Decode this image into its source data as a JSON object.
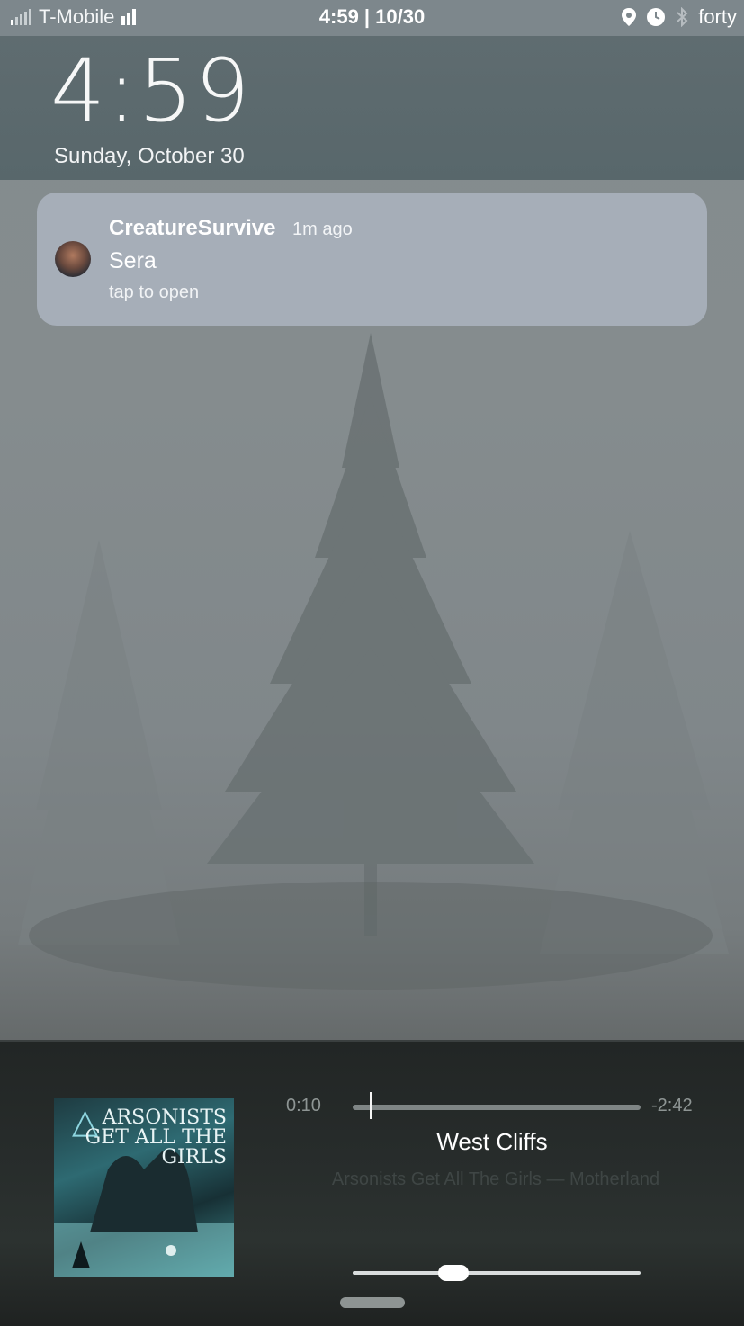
{
  "status_bar": {
    "carrier": "T-Mobile",
    "center": "4:59 | 10/30",
    "right_label": "forty",
    "icons": [
      "signal-icon",
      "wifi-bars-icon",
      "location-icon",
      "alarm-icon",
      "bluetooth-icon"
    ]
  },
  "lock": {
    "time": "4:59",
    "date": "Sunday, October 30"
  },
  "notification": {
    "app": "CreatureSurvive",
    "time": "1m ago",
    "title": "Sera",
    "hint": "tap to open"
  },
  "player": {
    "elapsed": "0:10",
    "remaining": "-2:42",
    "progress": 0.06,
    "title": "West Cliffs",
    "subtitle": "Arsonists Get All The Girls — Motherland",
    "volume": 0.35,
    "album_art_text": "ARSONISTS GET ALL THE GIRLS"
  }
}
